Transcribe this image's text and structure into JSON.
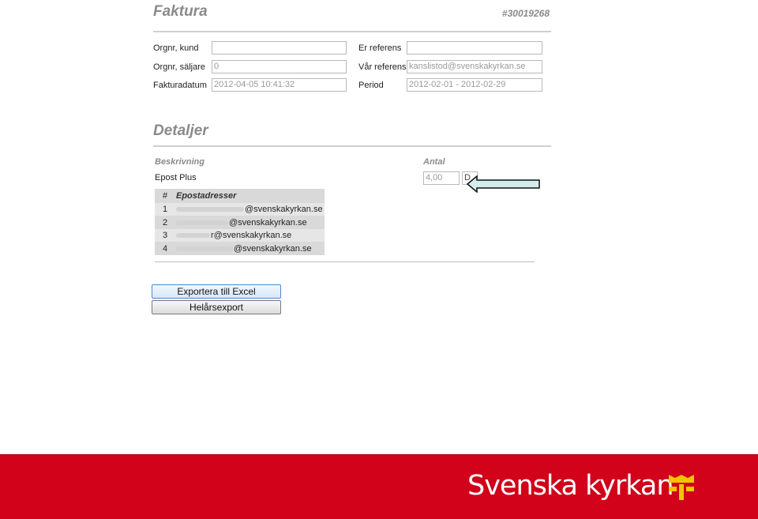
{
  "invoice": {
    "title": "Faktura",
    "number": "#30019268",
    "fields": {
      "orgnr_kund_label": "Orgnr, kund",
      "orgnr_kund_value": "",
      "orgnr_saljare_label": "Orgnr, säljare",
      "orgnr_saljare_value": "0",
      "fakturadatum_label": "Fakturadatum",
      "fakturadatum_value": "2012-04-05 10:41:32",
      "er_referens_label": "Er referens",
      "er_referens_value": "",
      "var_referens_label": "Vår referens",
      "var_referens_value": "kanslistod@svenskakyrkan.se",
      "period_label": "Period",
      "period_value": "2012-02-01 - 2012-02-29"
    }
  },
  "details": {
    "title": "Detaljer",
    "col_beskrivning": "Beskrivning",
    "col_antal": "Antal",
    "item_name": "Epost Plus",
    "item_quantity": "4,00",
    "item_button": "D",
    "email_table": {
      "header_num": "#",
      "header_label": "Epostadresser",
      "rows": [
        {
          "num": "1",
          "address": "@svenskakyrkan.se"
        },
        {
          "num": "2",
          "address": "@svenskakyrkan.se"
        },
        {
          "num": "3",
          "address": "r@svenskakyrkan.se"
        },
        {
          "num": "4",
          "address": "@svenskakyrkan.se"
        }
      ]
    }
  },
  "actions": {
    "export_excel": "Exportera till Excel",
    "full_year_export": "Helårsexport"
  },
  "footer": {
    "brand": "Svenska kyrkan",
    "brand_color": "#d1021a",
    "logo_icon": "church-crown-logo"
  },
  "annotation": {
    "arrow_fill": "#d4ecec",
    "arrow_icon": "left-arrow-icon"
  }
}
